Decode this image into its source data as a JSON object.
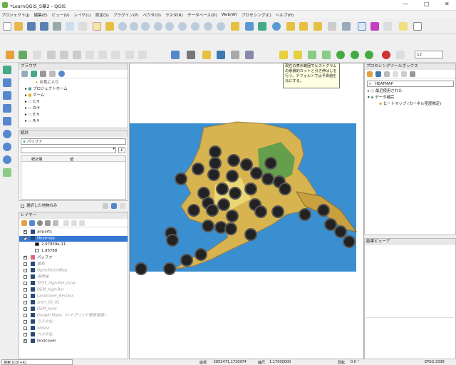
{
  "window": {
    "title": "*LearnQGIS_S章2 - QGIS",
    "min": "—",
    "max": "□",
    "close": "✕"
  },
  "menu": [
    "プロジェクト(J)",
    "編集(E)",
    "ビュー(V)",
    "レイヤ(L)",
    "設定(S)",
    "プラグイン(P)",
    "ベクタ(O)",
    "ラスタ(R)",
    "データベース(D)",
    "Web(W)",
    "プロセシング(C)",
    "ヘルプ(H)"
  ],
  "toolbar": {
    "zoom_value": "12"
  },
  "browser": {
    "title": "ブラウザ",
    "items": [
      "お気に入り",
      "プロジェクトホーム",
      "ホーム",
      "C:¥",
      "D:¥",
      "E:¥",
      "R:¥"
    ]
  },
  "stats": {
    "title": "統計",
    "layer": "バッファ",
    "col1": "統計量",
    "col2": "値",
    "selected_only": "選択した地物のみ"
  },
  "layers": {
    "title": "レイヤー",
    "items": [
      {
        "name": "airports",
        "checked": true,
        "active": true
      },
      {
        "name": "Heatmap",
        "checked": true,
        "active": true,
        "selected": true
      },
      {
        "name": "2.97959e-11",
        "legend": true
      },
      {
        "name": "1.85788",
        "legend": true
      },
      {
        "name": "バッファ",
        "checked": true,
        "active": true
      },
      {
        "name": "緩和",
        "checked": false,
        "active": false
      },
      {
        "name": "OpenStreetMap",
        "checked": false,
        "active": false
      },
      {
        "name": "海岸線",
        "checked": false,
        "active": false
      },
      {
        "name": "TEST_high-Rel_local",
        "checked": false,
        "active": false
      },
      {
        "name": "DEM_high-Rel",
        "checked": false,
        "active": false
      },
      {
        "name": "Landcover_Reclass",
        "checked": false,
        "active": false
      },
      {
        "name": "srtm_03_01",
        "checked": false,
        "active": false
      },
      {
        "name": "DEM_local",
        "checked": false,
        "active": false
      },
      {
        "name": "Google Maps（ハイブリッド衛星画像）",
        "checked": false,
        "active": false
      },
      {
        "name": "ラスタ化",
        "checked": false,
        "active": false
      },
      {
        "name": "alaska",
        "checked": false,
        "active": false
      },
      {
        "name": "ベクタ化",
        "checked": false,
        "active": false
      },
      {
        "name": "landcover",
        "checked": true,
        "active": true
      }
    ]
  },
  "tooltip": "現在の表示範囲でヒストグラムの累積的カットと引き伸ばしを行う。デフォルトでは予測値を元にする。",
  "processing": {
    "title": "プロセシングツールボックス",
    "search": "HEATMAP",
    "recent": "最近使用された",
    "group": "データ補完",
    "algorithm": "ヒートマップ (カーネル密度推定)"
  },
  "results": {
    "title": "結果ビューア"
  },
  "status": {
    "coord_label": "座標",
    "coord": "-2852471,1720974",
    "scale_label": "縮尺",
    "scale": "1:17000000",
    "search": "検索 (Ctrl+K)",
    "rotation_label": "回転",
    "rotation": "0.0 °",
    "epsg": "EPSG:3338"
  },
  "colors": {
    "sea": "#3a8fd0",
    "selected": "#3478d4",
    "legend_lo": "#000000",
    "legend_hi": "#ffffff",
    "buffer": "#e06080"
  }
}
